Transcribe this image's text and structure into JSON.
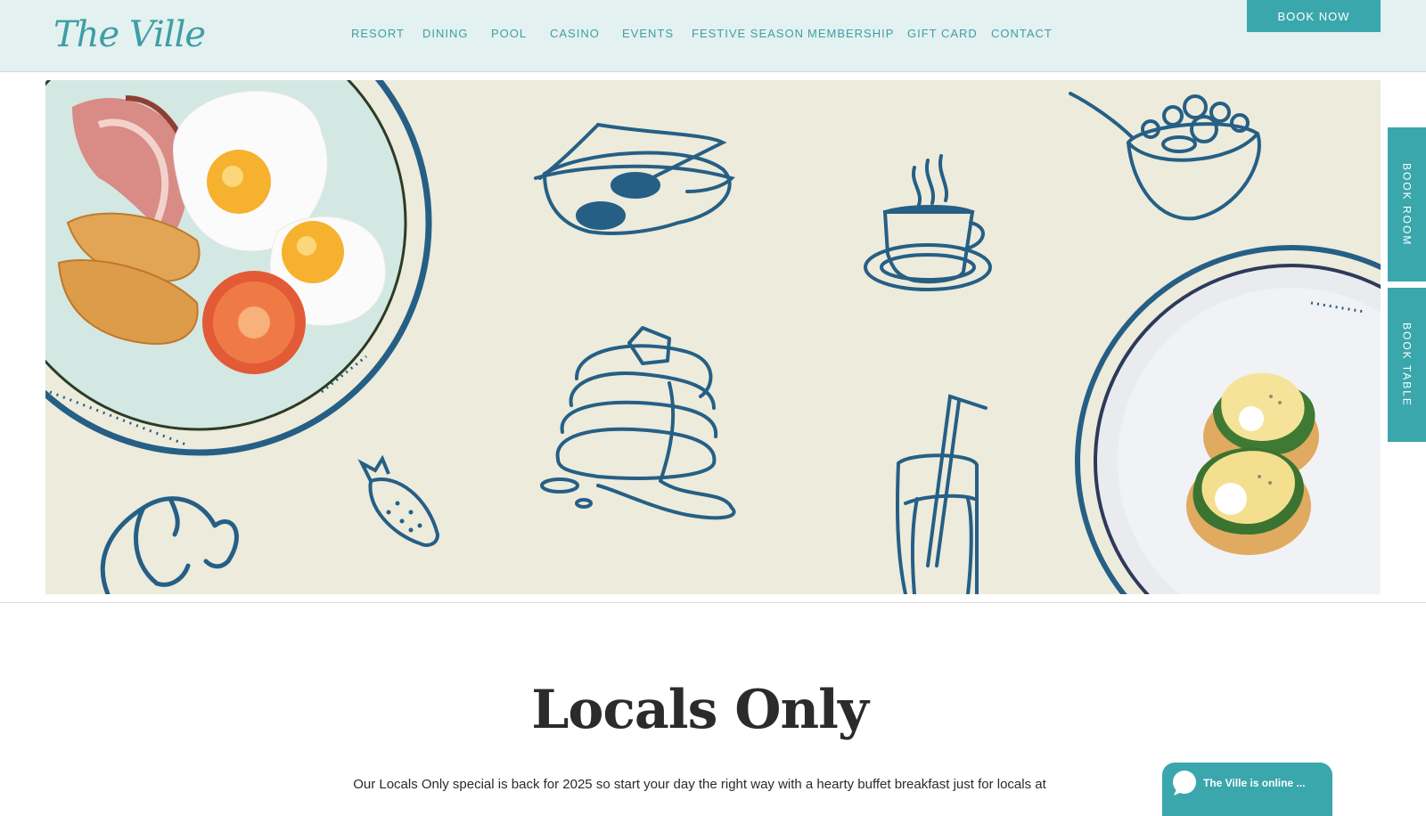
{
  "header": {
    "logo_text": "The Ville",
    "nav": [
      "RESORT",
      "DINING",
      "POOL",
      "CASINO",
      "EVENTS",
      "FESTIVE SEASON",
      "MEMBERSHIP",
      "GIFT CARD",
      "CONTACT"
    ],
    "book_now": "BOOK NOW"
  },
  "side_tabs": {
    "book_room": "BOOK ROOM",
    "book_table": "BOOK TABLE"
  },
  "content": {
    "title": "Locals Only",
    "description": "Our Locals Only special is back for 2025 so start your day the right way with a hearty buffet breakfast just for locals at"
  },
  "chat": {
    "label": "The Ville is online ..."
  },
  "icons": [
    "chat-bubble-icon"
  ],
  "colors": {
    "accent": "#3aa7ad",
    "nav_text": "#3f9ea4",
    "header_bg": "#e3f1f1",
    "hero_bg": "#ecebdc",
    "illustration": "#265f85"
  }
}
